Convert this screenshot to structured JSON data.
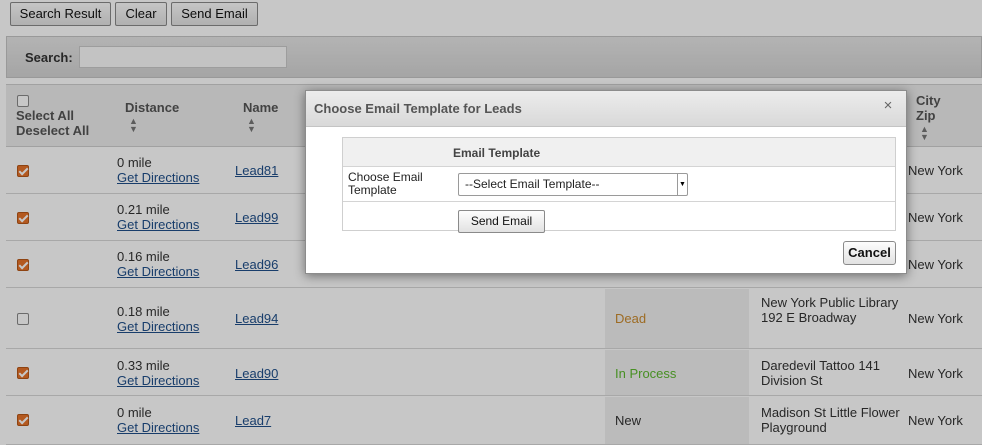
{
  "toolbar": {
    "search_result": "Search Result",
    "clear": "Clear",
    "send_email": "Send Email"
  },
  "search": {
    "label": "Search:",
    "value": ""
  },
  "table": {
    "headers": {
      "select_all": "Select All",
      "deselect_all": "Deselect All",
      "distance": "Distance",
      "name": "Name",
      "city_zip_1": "City",
      "city_zip_2": "Zip"
    },
    "get_directions": "Get Directions",
    "rows": [
      {
        "checked": true,
        "distance": "0 mile",
        "name": "Lead81",
        "status": "",
        "status_color": "",
        "address": "",
        "city": "New York"
      },
      {
        "checked": true,
        "distance": "0.21 mile",
        "name": "Lead99",
        "status": "",
        "status_color": "",
        "address": "",
        "city": "New York"
      },
      {
        "checked": true,
        "distance": "0.16 mile",
        "name": "Lead96",
        "status": "",
        "status_color": "",
        "address": "",
        "city": "New York"
      },
      {
        "checked": false,
        "distance": "0.18 mile",
        "name": "Lead94",
        "status": "Dead",
        "status_color": "#c98a2e",
        "address": "New York Public Library 192 E Broadway",
        "city": "New York"
      },
      {
        "checked": true,
        "distance": "0.33 mile",
        "name": "Lead90",
        "status": "In Process",
        "status_color": "#5cb82e",
        "address": "Daredevil Tattoo 141 Division St",
        "city": "New York"
      },
      {
        "checked": true,
        "distance": "0 mile",
        "name": "Lead7",
        "status": "New",
        "status_color": "#333333",
        "address": "Madison St Little Flower Playground",
        "city": "New York"
      }
    ]
  },
  "modal": {
    "title": "Choose Email Template for Leads",
    "close": "×",
    "section_header": "Email Template",
    "field_label": "Choose Email Template",
    "select_value": "--Select Email Template--",
    "send_button": "Send Email",
    "cancel_button": "Cancel"
  },
  "colors": {
    "checkbox_checked": "#e6732a",
    "link": "#1f4f8a"
  }
}
